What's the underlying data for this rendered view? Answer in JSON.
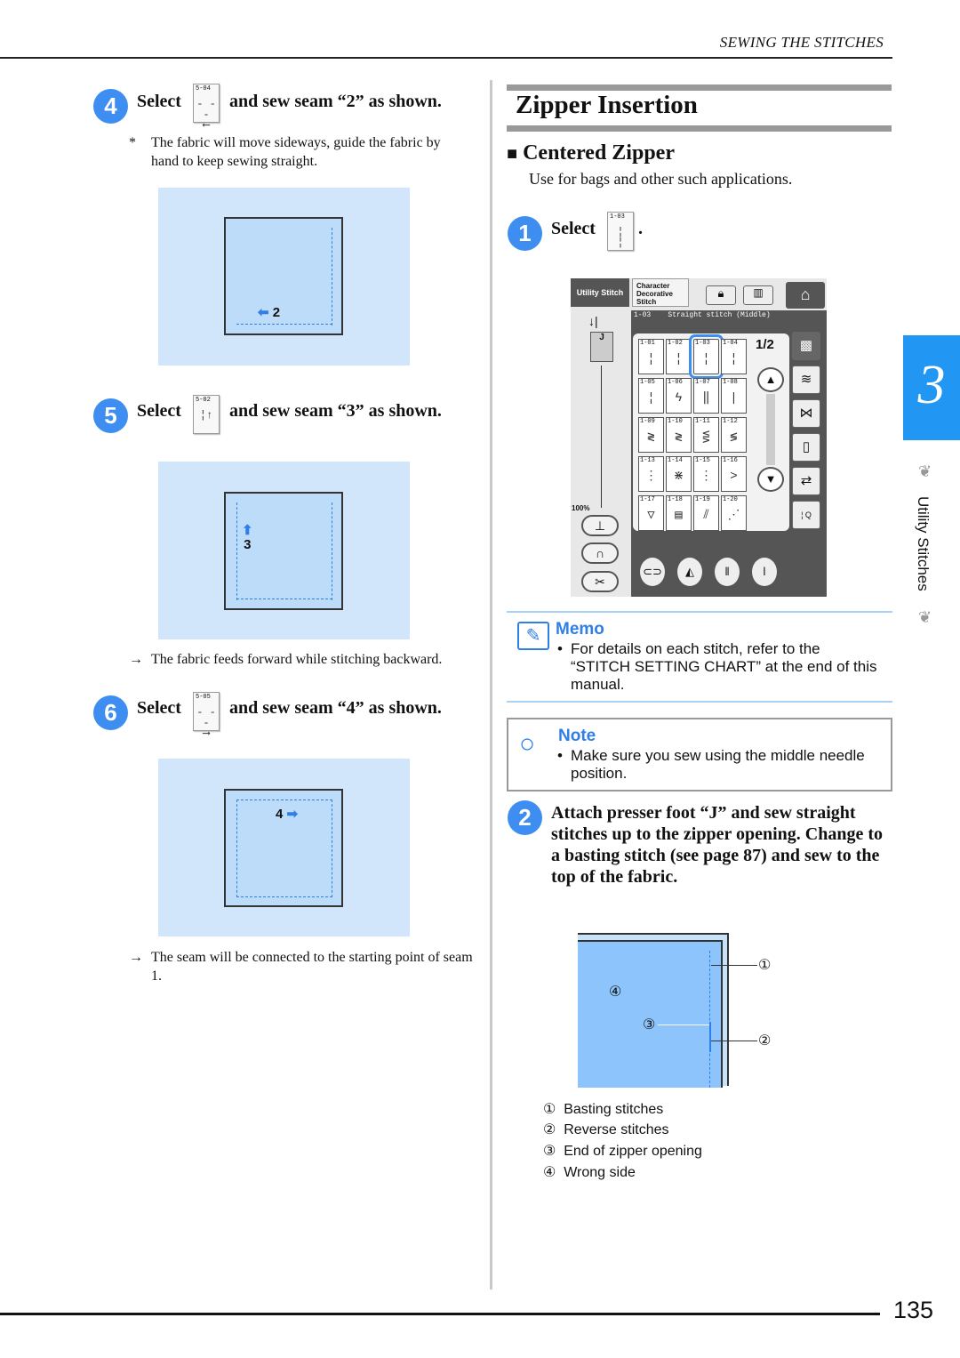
{
  "header": {
    "section": "SEWING THE STITCHES",
    "page_number": "135"
  },
  "side_tab": {
    "chapter": "3",
    "label": "Utility Stitches",
    "color": "#2196f3"
  },
  "left": {
    "steps": [
      {
        "number": "4",
        "select": "Select",
        "stitch_code": "5-04",
        "action": "and sew seam “2” as shown.",
        "diagram_label": "2"
      },
      {
        "number": "5",
        "select": "Select",
        "stitch_code": "5-02",
        "action": "and sew seam “3” as shown.",
        "diagram_label": "3"
      },
      {
        "number": "6",
        "select": "Select",
        "stitch_code": "5-05",
        "action": "and sew seam “4” as shown.",
        "diagram_label": "4"
      }
    ],
    "note_star": "*",
    "note_4": "The fabric will move sideways, guide the fabric by hand to keep sewing straight.",
    "arrow_glyph": "→",
    "note_5": "The fabric feeds forward while stitching backward.",
    "note_6": "The seam will be connected to the starting point of seam 1."
  },
  "right": {
    "title": "Zipper Insertion",
    "subtitle_bullet": "■",
    "subtitle": "Centered Zipper",
    "intro": "Use for bags and other such applications.",
    "step1": {
      "number": "1",
      "select": "Select",
      "stitch_code": "1-03",
      "period": "."
    },
    "screen": {
      "tab_utility": "Utility Stitch",
      "tab_character": "Character Decorative Stitch",
      "selected_code": "1-03",
      "selected_name": "Straight stitch (Middle)",
      "presser_foot": "J",
      "zoom": "100%",
      "page": "1/2",
      "cells": [
        "1-01",
        "1-02",
        "1-03",
        "1-04",
        "1-05",
        "1-06",
        "1-07",
        "1-08",
        "1-09",
        "1-10",
        "1-11",
        "1-12",
        "1-13",
        "1-14",
        "1-15",
        "1-16",
        "1-17",
        "1-18",
        "1-19",
        "1-20"
      ],
      "accent": "#3d8ef0"
    },
    "memo": {
      "title": "Memo",
      "bullet": "•",
      "text": "For details on each stitch, refer to the “STITCH SETTING CHART” at the end of this manual."
    },
    "note": {
      "title": "Note",
      "bullet": "•",
      "text": "Make sure you sew using the middle needle position."
    },
    "step2": {
      "number": "2",
      "text": "Attach presser foot “J” and sew straight stitches up to the zipper opening. Change to a basting stitch (see page 87) and sew to the top of the fabric."
    },
    "callouts": [
      "①",
      "②",
      "③",
      "④"
    ],
    "legend": [
      {
        "mark": "①",
        "label": "Basting stitches"
      },
      {
        "mark": "②",
        "label": "Reverse stitches"
      },
      {
        "mark": "③",
        "label": "End of zipper opening"
      },
      {
        "mark": "④",
        "label": "Wrong side"
      }
    ]
  }
}
